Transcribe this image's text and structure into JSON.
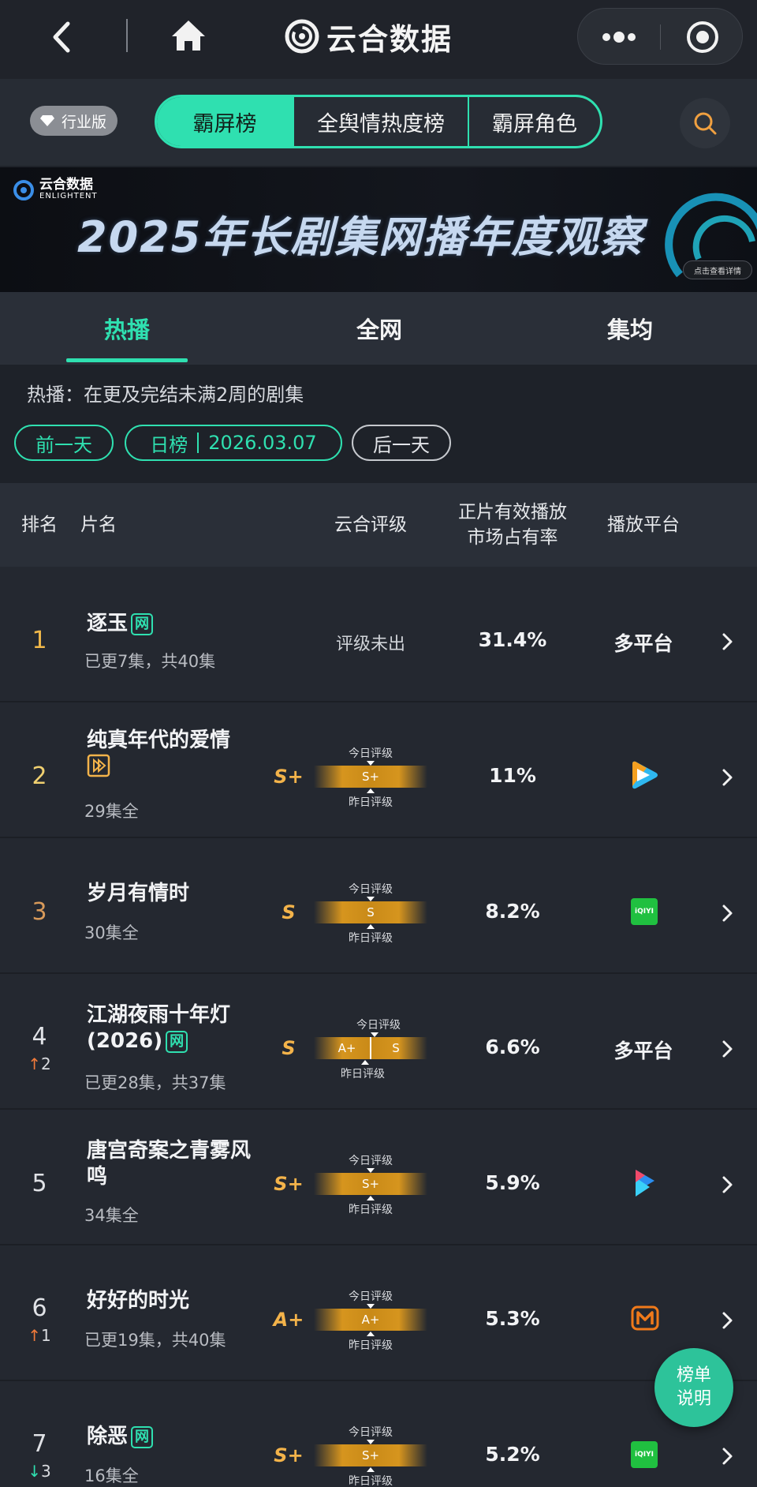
{
  "header": {
    "app_title": "云合数据",
    "icons": {
      "back": "back-chevron-icon",
      "home": "home-icon",
      "more": "more-dots-icon",
      "target": "target-circle-icon"
    }
  },
  "filter_bar": {
    "edition_label": "行业版",
    "segments": [
      {
        "label": "霸屏榜",
        "active": true
      },
      {
        "label": "全舆情热度榜",
        "active": false
      },
      {
        "label": "霸屏角色",
        "active": false
      }
    ]
  },
  "banner": {
    "logo_cn": "云合数据",
    "logo_en": "ENLIGHTENT",
    "title": "2025年长剧集网播年度观察",
    "button": "点击查看详情"
  },
  "tabs": [
    {
      "label": "热播",
      "active": true
    },
    {
      "label": "全网",
      "active": false
    },
    {
      "label": "集均",
      "active": false
    }
  ],
  "description": "热播：在更及完结未满2周的剧集",
  "date_nav": {
    "prev": "前一天",
    "type": "日榜",
    "date": "2026.03.07",
    "next": "后一天"
  },
  "table": {
    "headers": {
      "rank": "排名",
      "title": "片名",
      "rating": "云合评级",
      "share_line1": "正片有效播放",
      "share_line2": "市场占有率",
      "platform": "播放平台"
    },
    "rating_labels": {
      "today": "今日评级",
      "yesterday": "昨日评级"
    },
    "rows": [
      {
        "rank": "1",
        "title": "逐玉",
        "badge": "网",
        "sub": "已更7集，共40集",
        "rating_text": "评级未出",
        "share": "31.4%",
        "platform_text": "多平台",
        "platform_icon": ""
      },
      {
        "rank": "2",
        "title": "纯真年代的爱情",
        "badge_icon": "play-box-icon",
        "sub": "29集全",
        "grade": "S+",
        "today": "S+",
        "yesterday": "",
        "share": "11%",
        "platform_icon": "tencent-video-icon"
      },
      {
        "rank": "3",
        "title": "岁月有情时",
        "sub": "30集全",
        "grade": "S",
        "today": "S",
        "yesterday": "",
        "share": "8.2%",
        "platform_icon": "iqiyi-icon",
        "platform_label": "iQIYI"
      },
      {
        "rank": "4",
        "change": "2",
        "change_dir": "up",
        "title": "江湖夜雨十年灯(2026)",
        "badge": "网",
        "sub": "已更28集，共37集",
        "grade": "S",
        "today": "S",
        "yesterday": "A+",
        "share": "6.6%",
        "platform_text": "多平台"
      },
      {
        "rank": "5",
        "title": "唐宫奇案之青雾风鸣",
        "sub": "34集全",
        "grade": "S+",
        "today": "S+",
        "yesterday": "",
        "share": "5.9%",
        "platform_icon": "youku-icon"
      },
      {
        "rank": "6",
        "change": "1",
        "change_dir": "up",
        "title": "好好的时光",
        "sub": "已更19集，共40集",
        "grade": "A+",
        "today": "A+",
        "yesterday": "",
        "share": "5.3%",
        "platform_icon": "mango-tv-icon"
      },
      {
        "rank": "7",
        "change": "3",
        "change_dir": "down",
        "title": "除恶",
        "badge": "网",
        "sub": "16集全",
        "grade": "S+",
        "today": "S+",
        "yesterday": "",
        "share": "5.2%",
        "platform_icon": "iqiyi-icon",
        "platform_label": "iQIYI"
      }
    ]
  },
  "fab": {
    "line1": "榜单",
    "line2": "说明"
  },
  "colors": {
    "accent": "#2fe0b0",
    "grade": "#f3b34a",
    "rank_gold": "#f0b84a",
    "up": "#f07a3a",
    "down": "#2fe0b0",
    "background": "#1e2229"
  }
}
